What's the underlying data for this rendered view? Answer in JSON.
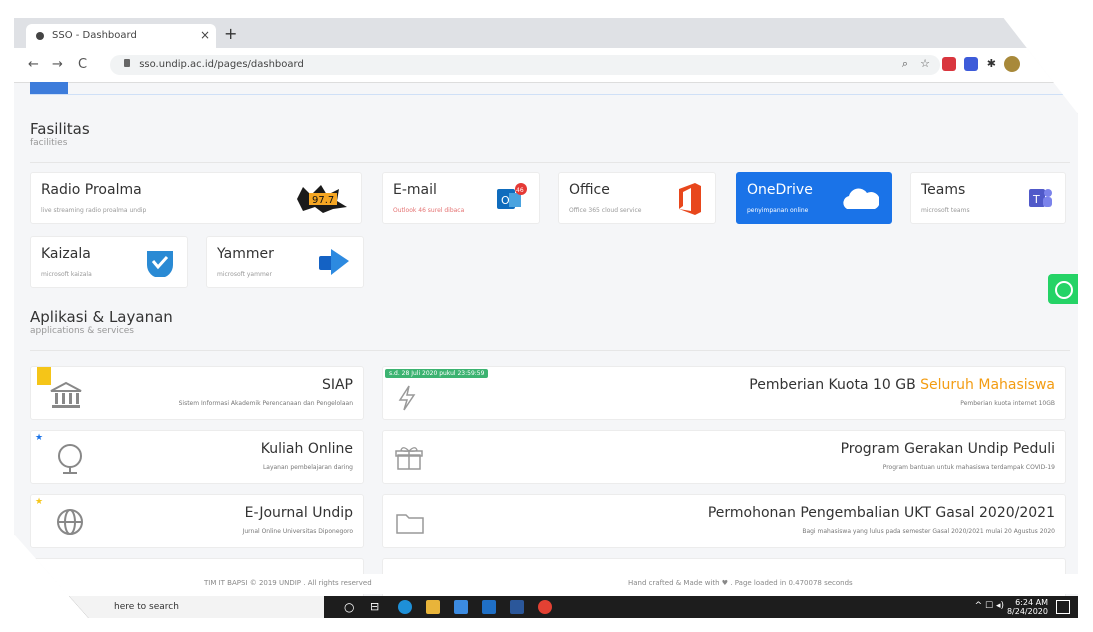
{
  "browser": {
    "tab_title": "SSO - Dashboard",
    "tab_close": "×",
    "new_tab": "+",
    "url": "sso.undip.ac.id/pages/dashboard",
    "back": "←",
    "forward": "→",
    "reload": "C"
  },
  "fasilitas": {
    "title": "Fasilitas",
    "subtitle": "facilities",
    "items": [
      {
        "name": "Radio Proalma",
        "desc": "live streaming radio proalma undip"
      },
      {
        "name": "E-mail",
        "desc": "Outlook 46 surel dibaca"
      },
      {
        "name": "Office",
        "desc": "Office 365 cloud service"
      },
      {
        "name": "OneDrive",
        "desc": "penyimpanan online"
      },
      {
        "name": "Teams",
        "desc": "microsoft teams"
      },
      {
        "name": "Kaizala",
        "desc": "microsoft kaizala"
      },
      {
        "name": "Yammer",
        "desc": "microsoft yammer"
      }
    ],
    "email_count": "46",
    "radio_badge": "97.7"
  },
  "aplikasi": {
    "title": "Aplikasi & Layanan",
    "subtitle": "applications & services",
    "left": [
      {
        "name": "SIAP",
        "desc": "Sistem Informasi Akademik Perencanaan dan Pengelolaan"
      },
      {
        "name": "Kuliah Online",
        "desc": "Layanan pembelajaran daring"
      },
      {
        "name": "E-Journal Undip",
        "desc": "Jurnal Online Universitas Diponegoro"
      }
    ],
    "right": [
      {
        "name_prefix": "Pemberian Kuota 10 GB ",
        "name_highlight": "Seluruh Mahasiswa",
        "desc": "Pemberian kuota internet 10GB",
        "badge": "s.d. 28 Juli 2020 pukul 23:59:59"
      },
      {
        "name": "Program Gerakan Undip Peduli",
        "desc": "Program bantuan untuk mahasiswa terdampak COVID-19"
      },
      {
        "name": "Permohonan Pengembalian UKT Gasal 2020/2021",
        "desc": "Bagi mahasiswa yang lulus pada semester Gasal 2020/2021 mulai 20 Agustus 2020"
      }
    ]
  },
  "footer": {
    "left": "TIM IT BAPSI © 2019 UNDIP . All rights reserved",
    "right": "Hand crafted & Made with ♥ . Page loaded in 0.470078 seconds"
  },
  "taskbar": {
    "search": "here to search",
    "time": "6:24 AM",
    "date": "8/24/2020"
  },
  "colors": {
    "accent": "#1a73e8",
    "highlight": "#f39c12",
    "whatsapp": "#25d366"
  }
}
